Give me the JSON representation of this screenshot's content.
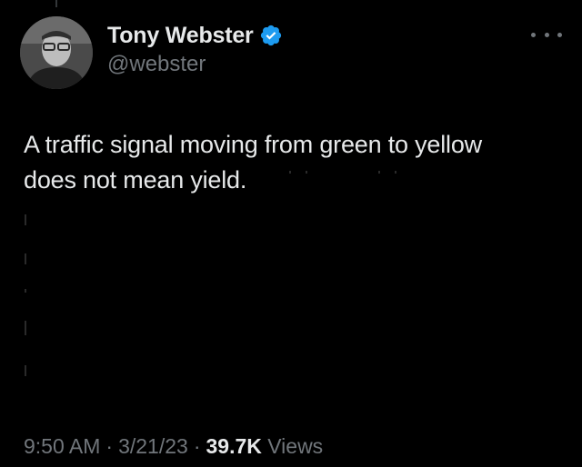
{
  "tweet": {
    "author": {
      "display_name": "Tony Webster",
      "handle": "@webster",
      "verified": true,
      "avatar_icon": "user-avatar"
    },
    "more_icon": "more-dots-icon",
    "text_lines": [
      "A traffic signal moving from green to yellow",
      "does not mean yield."
    ],
    "time": "9:50 AM",
    "date": "3/21/23",
    "separator": "·",
    "views_count": "39.7K",
    "views_label": "Views"
  },
  "colors": {
    "background": "#000000",
    "text_primary": "#e7e9ea",
    "text_secondary": "#71767b",
    "verified_badge": "#1d9bf0"
  }
}
